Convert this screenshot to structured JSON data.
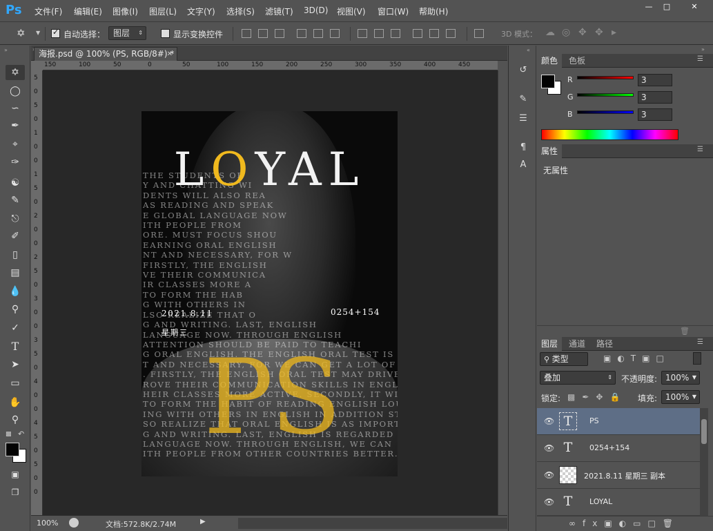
{
  "app": {
    "logo": "Ps"
  },
  "menu": [
    "文件(F)",
    "编辑(E)",
    "图像(I)",
    "图层(L)",
    "文字(Y)",
    "选择(S)",
    "滤镜(T)",
    "3D(D)",
    "视图(V)",
    "窗口(W)",
    "帮助(H)"
  ],
  "options": {
    "auto_select_label": "自动选择：",
    "auto_select_value": "图层",
    "show_transform_label": "显示变换控件",
    "mode3d_label": "3D 模式："
  },
  "document": {
    "tab_title": "海报.psd @ 100% (PS, RGB/8#) *",
    "ruler_h": [
      "150",
      "100",
      "50",
      "0",
      "50",
      "100",
      "150",
      "200",
      "250",
      "300",
      "350",
      "400",
      "450"
    ],
    "ruler_v": [
      "5",
      "0",
      "5",
      "0",
      "1",
      "0",
      "0",
      "1",
      "5",
      "0",
      "2",
      "0",
      "0",
      "2",
      "5",
      "0",
      "3",
      "0",
      "0",
      "3",
      "5",
      "0",
      "4",
      "0",
      "0",
      "4",
      "5",
      "0",
      "5",
      "0",
      "0"
    ]
  },
  "poster": {
    "title_before": "L",
    "title_accent": "O",
    "title_after": "YAL",
    "big_letters": "PS",
    "date": "2021.8.11",
    "number": "0254+154",
    "weekday": "星期三",
    "body_lines": [
      "THE STUDENTS OF",
      "Y AND CHATTING WI",
      "DENTS WILL ALSO REA",
      "AS READING AND SPEAK",
      "E GLOBAL LANGUAGE NOW",
      "ITH PEOPLE FROM",
      "ORE. MUST FOCUS SHOU",
      "EARNING ORAL ENGLISH",
      "NT AND NECESSARY, FOR W",
      "FIRSTLY, THE ENGLISH",
      "VE THEIR COMMUNICA",
      "IR CLASSES MORE A",
      "TO FORM THE HAB",
      "G WITH OTHERS IN",
      "LSO REALIZE THAT O",
      "G AND WRITING. LAST, ENGLISH",
      "LANGUAGE NOW. THROUGH ENGLISH",
      "ATTENTION SHOULD BE PAID TO TEACHI",
      "G ORAL ENGLISH. THE ENGLISH ORAL TEST IS",
      "T AND NECESSARY, FOR WE CAN GET A LOT OF",
      ". FIRSTLY, THE ENGLISH ORAL TEST MAY DRIVE",
      "ROVE THEIR COMMUNICATION SKILLS IN ENGL",
      "HEIR CLASSES MORE ACTIVE. SECONDLY, IT WI",
      "TO FORM THE HABIT OF READING ENGLISH LOU",
      "ING WITH OTHERS IN ENGLISH IN ADDITION ST",
      "SO REALIZE THAT ORAL ENGLISH IS AS IMPORT",
      "G AND WRITING. LAST, ENGLISH IS REGARDED",
      "LANGUAGE NOW. THROUGH ENGLISH, WE CAN",
      "ITH PEOPLE FROM OTHER COUNTRIES BETTER."
    ]
  },
  "status": {
    "zoom": "100%",
    "doc": "文档:572.8K/2.74M"
  },
  "color_panel": {
    "tabs": [
      "颜色",
      "色板"
    ],
    "r_label": "R",
    "g_label": "G",
    "b_label": "B",
    "r": "3",
    "g": "3",
    "b": "3"
  },
  "properties_panel": {
    "tab": "属性",
    "text": "无属性"
  },
  "layers_panel": {
    "tabs": [
      "图层",
      "通道",
      "路径"
    ],
    "filter_type": "类型",
    "blend_mode": "叠加",
    "opacity_label": "不透明度:",
    "opacity": "100%",
    "lock_label": "锁定:",
    "fill_label": "填充:",
    "fill": "100%",
    "layers": [
      {
        "name": "PS",
        "kind": "text",
        "selected": true
      },
      {
        "name": "0254+154",
        "kind": "text",
        "selected": false
      },
      {
        "name": "2021.8.11 星期三 副本",
        "kind": "raster",
        "selected": false
      },
      {
        "name": "LOYAL",
        "kind": "text",
        "selected": false
      }
    ]
  },
  "icons": {
    "text_layer_glyph": "T",
    "eye": "visibility-eye"
  }
}
